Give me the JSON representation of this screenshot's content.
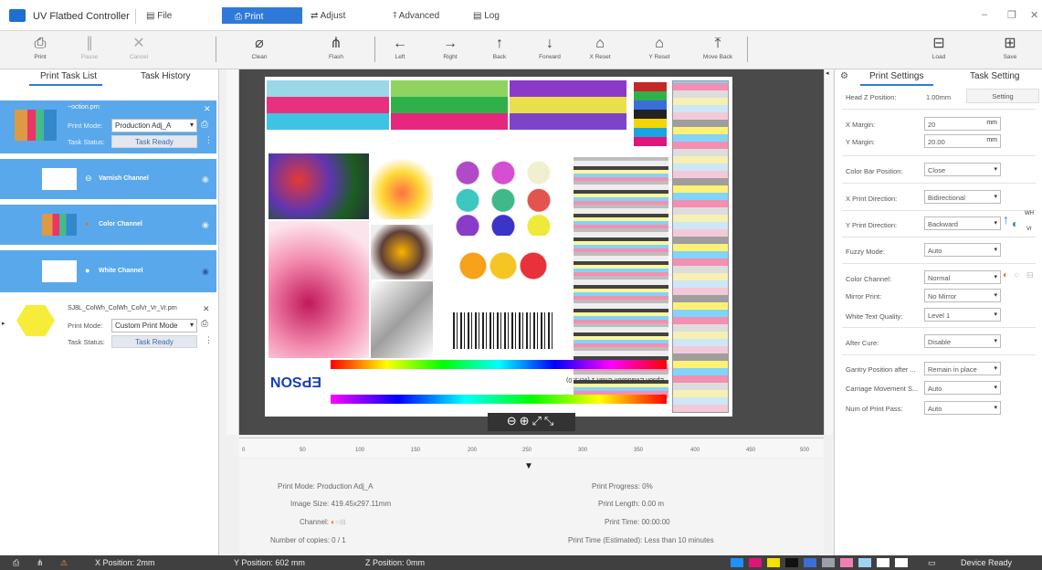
{
  "app": {
    "title": "UV Flatbed Controller"
  },
  "menu": {
    "file": "File",
    "print": "Print",
    "adjust": "Adjust",
    "advanced": "Advanced",
    "log": "Log"
  },
  "toolbar": {
    "print": "Print",
    "pause": "Pause",
    "cancel": "Cancel",
    "clean": "Clean",
    "flash": "Flash",
    "left": "Left",
    "right": "Right",
    "back": "Back",
    "forward": "Forward",
    "x_reset": "X Reset",
    "y_reset": "Y Reset",
    "move_back": "Move Back",
    "load": "Load",
    "save": "Save"
  },
  "left_panel": {
    "tabs": [
      "Print Task List",
      "Task History"
    ],
    "task1": {
      "filename": "~oction.prn",
      "print_mode_label": "Print Mode:",
      "print_mode": "Production Adj_A",
      "status_label": "Task Status:",
      "status": "Task Ready"
    },
    "channels": [
      {
        "label": "Varnish Channel"
      },
      {
        "label": "Color Channel"
      },
      {
        "label": "White Channel"
      }
    ],
    "task2": {
      "filename": "SJ8L_ColWh_ColWh_ColVr_Vr_Vr.prn",
      "print_mode_label": "Print Mode:",
      "print_mode": "Custom Print Mode",
      "status_label": "Task Status:",
      "status": "Task Ready"
    }
  },
  "canvas": {
    "ruler_ticks": [
      "0",
      "50",
      "100",
      "150",
      "200",
      "250",
      "300",
      "350",
      "400",
      "450",
      "500"
    ],
    "print_content": {
      "brand": "EPSON",
      "chart_title": "Epson Evaluation Chart 1 (ver.2.0)"
    }
  },
  "info": {
    "print_mode": "Print Mode: Production Adj_A",
    "image_size": "Image Size: 419.45x297.11mm",
    "channel": "Channel:",
    "copies": "Number of copies: 0 / 1",
    "progress": "Print Progress: 0%",
    "length": "Print Length: 0.00 m",
    "time": "Print Time: 00:00:00",
    "time_est": "Print Time (Estimated): Less than 10 minutes"
  },
  "right_panel": {
    "tabs": [
      "Print Settings",
      "Task Setting"
    ],
    "head_z": {
      "label": "Head Z Position:",
      "value": "1.00mm",
      "button": "Setting"
    },
    "x_margin": {
      "label": "X Margin:",
      "value": "20",
      "unit": "mm"
    },
    "y_margin": {
      "label": "Y Margin:",
      "value": "20.00",
      "unit": "mm"
    },
    "color_bar": {
      "label": "Color Bar Position:",
      "value": "Close"
    },
    "x_dir": {
      "label": "X Print Direction:",
      "value": "Bidirectional"
    },
    "y_dir": {
      "label": "Y Print Direction:",
      "value": "Backward",
      "badge_top": "WH",
      "badge_bottom": "Vr"
    },
    "fuzzy": {
      "label": "Fuzzy Mode:",
      "value": "Auto"
    },
    "color_channel": {
      "label": "Color Channel:",
      "value": "Normal"
    },
    "mirror": {
      "label": "Mirror Print:",
      "value": "No Mirror"
    },
    "white_text": {
      "label": "White Text Quality:",
      "value": "Level 1"
    },
    "after_cure": {
      "label": "After Cure:",
      "value": "Disable"
    },
    "gantry": {
      "label": "Gantry Position after ...",
      "value": "Remain in place"
    },
    "carriage": {
      "label": "Carriage Movement S...",
      "value": "Auto"
    },
    "passes": {
      "label": "Num of Print Pass:",
      "value": "Auto"
    }
  },
  "status_bar": {
    "x_pos": "X Position: 2mm",
    "y_pos": "Y Position: 602 mm",
    "z_pos": "Z Position: 0mm",
    "device": "Device Ready",
    "ink_colors": [
      "#1e90ff",
      "#e0147a",
      "#f5e100",
      "#111111",
      "#3a6fd8",
      "#9aa0aa",
      "#f27fb2",
      "#9cd2f5",
      "#ffffff",
      "#ffffff"
    ]
  }
}
